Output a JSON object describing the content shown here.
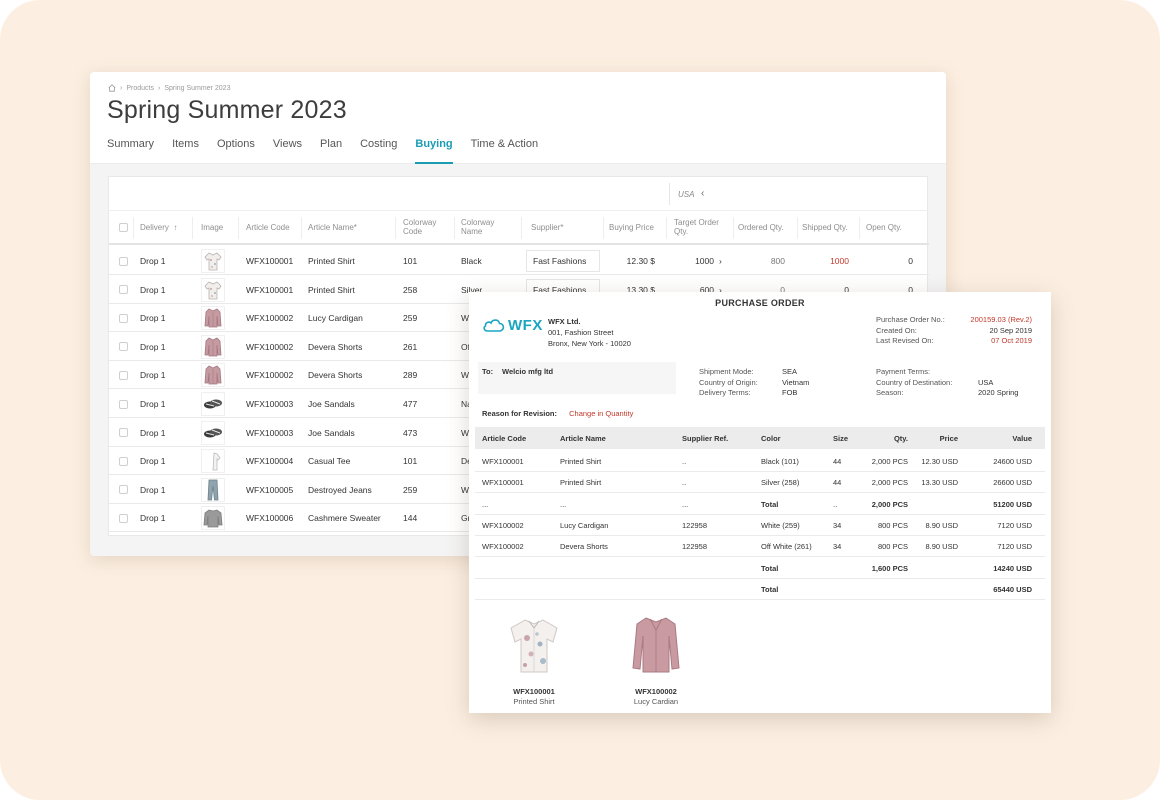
{
  "app": {
    "breadcrumb": [
      "Products",
      "Spring Summer 2023"
    ],
    "title": "Spring Summer 2023",
    "tabs": [
      "Summary",
      "Items",
      "Options",
      "Views",
      "Plan",
      "Costing",
      "Buying",
      "Time & Action"
    ],
    "active_tab": "Buying",
    "grid": {
      "region": "USA",
      "columns": [
        "Delivery",
        "Image",
        "Article Code",
        "Article Name*",
        "Colorway Code",
        "Colorway Name",
        "Supplier*",
        "Buying Price",
        "Target Order Qty.",
        "Ordered Qty.",
        "Shipped Qty.",
        "Open Qty."
      ],
      "rows": [
        {
          "delivery": "Drop 1",
          "image": "shirt-icon",
          "article_code": "WFX100001",
          "article_name": "Printed Shirt",
          "colorway_code": "101",
          "colorway_name": "Black",
          "supplier": "Fast Fashions",
          "buying_price": "12.30 $",
          "target_qty": "1000",
          "ordered_qty": "800",
          "shipped_qty": "1000",
          "open_qty": "0"
        },
        {
          "delivery": "Drop 1",
          "image": "shirt-icon",
          "article_code": "WFX100001",
          "article_name": "Printed Shirt",
          "colorway_code": "258",
          "colorway_name": "Silver",
          "supplier": "Fast Fashions",
          "buying_price": "13.30 $",
          "target_qty": "600",
          "ordered_qty": "0",
          "shipped_qty": "0",
          "open_qty": "0"
        },
        {
          "delivery": "Drop 1",
          "image": "cardigan-icon",
          "article_code": "WFX100002",
          "article_name": "Lucy Cardigan",
          "colorway_code": "259",
          "colorway_name": "W",
          "supplier": "",
          "buying_price": "",
          "target_qty": "",
          "ordered_qty": "",
          "shipped_qty": "",
          "open_qty": ""
        },
        {
          "delivery": "Drop 1",
          "image": "cardigan-icon",
          "article_code": "WFX100002",
          "article_name": "Devera Shorts",
          "colorway_code": "261",
          "colorway_name": "Of",
          "supplier": "",
          "buying_price": "",
          "target_qty": "",
          "ordered_qty": "",
          "shipped_qty": "",
          "open_qty": ""
        },
        {
          "delivery": "Drop 1",
          "image": "cardigan-icon",
          "article_code": "WFX100002",
          "article_name": "Devera Shorts",
          "colorway_code": "289",
          "colorway_name": "W",
          "supplier": "",
          "buying_price": "",
          "target_qty": "",
          "ordered_qty": "",
          "shipped_qty": "",
          "open_qty": ""
        },
        {
          "delivery": "Drop 1",
          "image": "sandals-icon",
          "article_code": "WFX100003",
          "article_name": "Joe Sandals",
          "colorway_code": "477",
          "colorway_name": "Na",
          "supplier": "",
          "buying_price": "",
          "target_qty": "",
          "ordered_qty": "",
          "shipped_qty": "",
          "open_qty": ""
        },
        {
          "delivery": "Drop 1",
          "image": "sandals-icon",
          "article_code": "WFX100003",
          "article_name": "Joe Sandals",
          "colorway_code": "473",
          "colorway_name": "W",
          "supplier": "",
          "buying_price": "",
          "target_qty": "",
          "ordered_qty": "",
          "shipped_qty": "",
          "open_qty": ""
        },
        {
          "delivery": "Drop 1",
          "image": "tee-icon",
          "article_code": "WFX100004",
          "article_name": "Casual Tee",
          "colorway_code": "101",
          "colorway_name": "De",
          "supplier": "",
          "buying_price": "",
          "target_qty": "",
          "ordered_qty": "",
          "shipped_qty": "",
          "open_qty": ""
        },
        {
          "delivery": "Drop 1",
          "image": "jeans-icon",
          "article_code": "WFX100005",
          "article_name": "Destroyed Jeans",
          "colorway_code": "259",
          "colorway_name": "W",
          "supplier": "",
          "buying_price": "",
          "target_qty": "",
          "ordered_qty": "",
          "shipped_qty": "",
          "open_qty": ""
        },
        {
          "delivery": "Drop 1",
          "image": "sweater-icon",
          "article_code": "WFX100006",
          "article_name": "Cashmere Sweater",
          "colorway_code": "144",
          "colorway_name": "Gr",
          "supplier": "",
          "buying_price": "",
          "target_qty": "",
          "ordered_qty": "",
          "shipped_qty": "",
          "open_qty": ""
        }
      ]
    }
  },
  "po": {
    "title": "PURCHASE ORDER",
    "logo_text": "WFX",
    "company": {
      "name": "WFX Ltd.",
      "address1": "001, Fashion Street",
      "address2": "Bronx, New York - 10020"
    },
    "meta": [
      {
        "label": "Purchase Order No.:",
        "value": "200159.03 (Rev.2)",
        "highlight": true
      },
      {
        "label": "Created On:",
        "value": "20 Sep 2019",
        "highlight": false
      },
      {
        "label": "Last Revised On:",
        "value": "07 Oct 2019",
        "highlight": true
      }
    ],
    "to_label": "To:",
    "to_value": "Welcio mfg ltd",
    "shipment": [
      {
        "label": "Shipment Mode:",
        "value": "SEA"
      },
      {
        "label": "Country of Origin:",
        "value": "Vietnam"
      },
      {
        "label": "Delivery Terms:",
        "value": "FOB"
      }
    ],
    "payment": [
      {
        "label": "Payment Terms:",
        "value": ""
      },
      {
        "label": "Country of Destination:",
        "value": "USA"
      },
      {
        "label": "Season:",
        "value": "2020 Spring"
      }
    ],
    "revision_label": "Reason for Revision:",
    "revision_value": "Change in Quantity",
    "columns": [
      "Article Code",
      "Article Name",
      "Supplier Ref.",
      "Color",
      "Size",
      "Qty.",
      "Price",
      "Value"
    ],
    "rows": [
      {
        "code": "WFX100001",
        "name": "Printed Shirt",
        "ref": "..",
        "color": "Black (101)",
        "size": "44",
        "qty": "2,000 PCS",
        "price": "12.30 USD",
        "value": "24600 USD",
        "bold": false
      },
      {
        "code": "WFX100001",
        "name": "Printed Shirt",
        "ref": "..",
        "color": "Silver (258)",
        "size": "44",
        "qty": "2,000 PCS",
        "price": "13.30 USD",
        "value": "26600 USD",
        "bold": false
      },
      {
        "code": "...",
        "name": "...",
        "ref": "...",
        "color": "Total",
        "size": "..",
        "qty": "2,000 PCS",
        "price": "",
        "value": "51200 USD",
        "bold": true
      },
      {
        "code": "WFX100002",
        "name": "Lucy Cardigan",
        "ref": "122958",
        "color": "White (259)",
        "size": "34",
        "qty": "800 PCS",
        "price": "8.90 USD",
        "value": "7120 USD",
        "bold": false
      },
      {
        "code": "WFX100002",
        "name": "Devera Shorts",
        "ref": "122958",
        "color": "Off White (261)",
        "size": "34",
        "qty": "800 PCS",
        "price": "8.90 USD",
        "value": "7120 USD",
        "bold": false
      },
      {
        "code": "",
        "name": "",
        "ref": "",
        "color": "Total",
        "size": "",
        "qty": "1,600 PCS",
        "price": "",
        "value": "14240 USD",
        "bold": true
      },
      {
        "code": "",
        "name": "",
        "ref": "",
        "color": "Total",
        "size": "",
        "qty": "",
        "price": "",
        "value": "65440 USD",
        "bold": true
      }
    ],
    "products": [
      {
        "code": "WFX100001",
        "name": "Printed Shirt",
        "image": "printed-shirt-image"
      },
      {
        "code": "WFX100002",
        "name": "Lucy Cardian",
        "image": "cardigan-image"
      }
    ]
  },
  "colors": {
    "accent": "#1a9cb3",
    "warning_red": "#c0392b",
    "background": "#fcefe1"
  }
}
